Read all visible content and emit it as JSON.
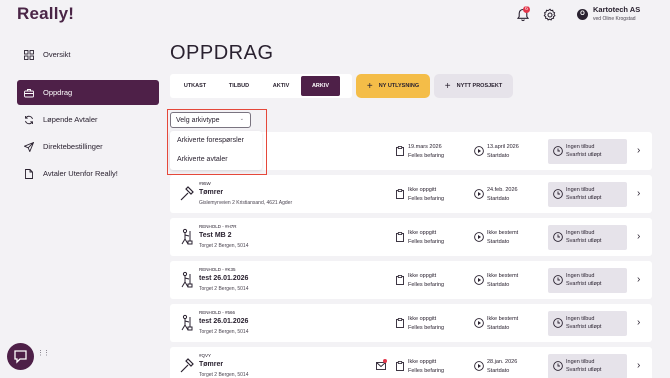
{
  "app": {
    "logo": "Really!"
  },
  "header": {
    "notification_count": "6",
    "company_name": "Kartotech AS",
    "company_user": "ved Oline Krogstad",
    "avatar_initial": "O"
  },
  "sidebar": {
    "items": [
      {
        "label": "Oversikt",
        "icon": "grid-icon",
        "active": false
      },
      {
        "label": "Oppdrag",
        "icon": "briefcase-icon",
        "active": true
      },
      {
        "label": "Løpende Avtaler",
        "icon": "refresh-icon",
        "active": false
      },
      {
        "label": "Direktebestillinger",
        "icon": "send-icon",
        "active": false
      },
      {
        "label": "Avtaler Utenfor Really!",
        "icon": "document-icon",
        "active": false
      }
    ]
  },
  "main": {
    "title": "OPPDRAG",
    "tabs": [
      {
        "label": "UTKAST",
        "active": false
      },
      {
        "label": "TILBUD",
        "active": false
      },
      {
        "label": "AKTIV",
        "active": false
      },
      {
        "label": "ARKIV",
        "active": true
      }
    ],
    "new_tender_label": "NY UTLYSNING",
    "new_project_label": "NYTT PROSJEKT",
    "archive_select": {
      "value": "Velg arkivtype",
      "options": [
        "Arkiverte forespørsler",
        "Arkiverte avtaler"
      ]
    }
  },
  "cards": [
    {
      "code": "",
      "title": "",
      "address": "",
      "has_mail": false,
      "date1": "19.mars 2026",
      "date1_sub": "Felles befaring",
      "date2": "13.april 2026",
      "date2_sub": "Startdato",
      "status": "Ingen tilbud",
      "status_sub": "Svarfrist utløpt",
      "icon": ""
    },
    {
      "code": "#95W",
      "title": "Tømrer",
      "address": "Gislemyrveien 2 Kristiansand, 4621 Agder",
      "has_mail": false,
      "date1": "Ikke oppgitt",
      "date1_sub": "Felles befaring",
      "date2": "24.feb. 2026",
      "date2_sub": "Startdato",
      "status": "Ingen tilbud",
      "status_sub": "Svarfrist utløpt",
      "icon": "hammer-icon"
    },
    {
      "code": "RENHOLD - #H7R",
      "title": "Test MB 2",
      "address": "Torget 2 Bergen, 5014",
      "has_mail": false,
      "date1": "Ikke oppgitt",
      "date1_sub": "Felles befaring",
      "date2": "Ikke bestemt",
      "date2_sub": "Startdato",
      "status": "Ingen tilbud",
      "status_sub": "Svarfrist utløpt",
      "icon": "cleaner-icon"
    },
    {
      "code": "RENHOLD - #K35",
      "title": "test 26.01.2026",
      "address": "Torget 2 Bergen, 5014",
      "has_mail": false,
      "date1": "Ikke oppgitt",
      "date1_sub": "Felles befaring",
      "date2": "Ikke bestemt",
      "date2_sub": "Startdato",
      "status": "Ingen tilbud",
      "status_sub": "Svarfrist utløpt",
      "icon": "cleaner-icon"
    },
    {
      "code": "RENHOLD - #566",
      "title": "test 26.01.2026",
      "address": "Torget 2 Bergen, 5014",
      "has_mail": false,
      "date1": "Ikke oppgitt",
      "date1_sub": "Felles befaring",
      "date2": "Ikke bestemt",
      "date2_sub": "Startdato",
      "status": "Ingen tilbud",
      "status_sub": "Svarfrist utløpt",
      "icon": "cleaner-icon"
    },
    {
      "code": "#QVY",
      "title": "Tømrer",
      "address": "Torget 2 Bergen, 5014",
      "has_mail": true,
      "date1": "Ikke oppgitt",
      "date1_sub": "Felles befaring",
      "date2": "28.jan. 2026",
      "date2_sub": "Startdato",
      "status": "Ingen tilbud",
      "status_sub": "Svarfrist utløpt",
      "icon": "hammer-icon"
    }
  ],
  "colors": {
    "brand": "#4e2048",
    "accent": "#f4bd48",
    "highlight": "#e5483a",
    "badge": "#e2364a"
  }
}
